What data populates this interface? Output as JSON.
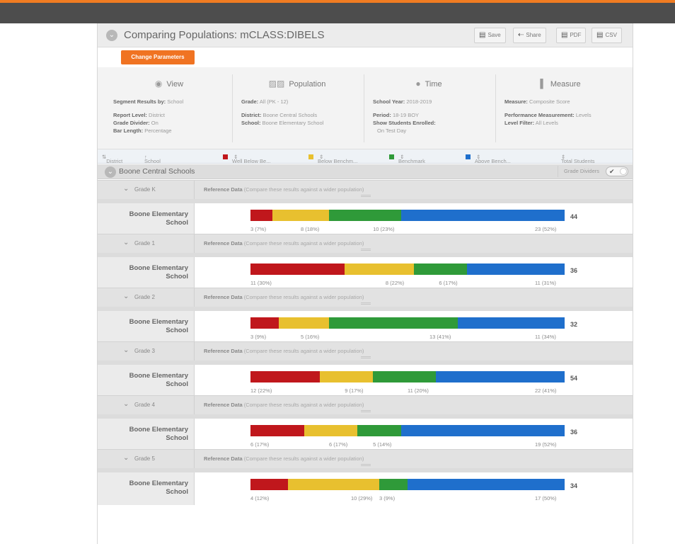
{
  "title": "Comparing Populations: mCLASS:DIBELS",
  "toolbar": {
    "save": "Save",
    "share": "Share",
    "pdf": "PDF",
    "csv": "CSV",
    "change_parameters": "Change Parameters"
  },
  "params": {
    "view": {
      "heading": "View",
      "segment_label": "Segment Results by:",
      "segment_value": "School",
      "level_label": "Report Level:",
      "level_value": "District",
      "divider_label": "Grade Divider:",
      "divider_value": "On",
      "bar_label": "Bar Length:",
      "bar_value": "Percentage"
    },
    "population": {
      "heading": "Population",
      "grade_label": "Grade:",
      "grade_value": "All (PK - 12)",
      "district_label": "District:",
      "district_value": "Boone Central Schools",
      "school_label": "School:",
      "school_value": "Boone Elementary School"
    },
    "time": {
      "heading": "Time",
      "year_label": "School Year:",
      "year_value": "2018-2019",
      "period_label": "Period:",
      "period_value": "18-19 BOY",
      "show_label": "Show Students Enrolled:",
      "show_value": "On Test Day"
    },
    "measure": {
      "heading": "Measure",
      "measure_label": "Measure:",
      "measure_value": "Composite Score",
      "perf_label": "Performance Measurement:",
      "perf_value": "Levels",
      "filter_label": "Level Filter:",
      "filter_value": "All Levels"
    }
  },
  "columns": {
    "district": "District",
    "school": "School",
    "well_below": "Well Below Be...",
    "below": "Below Benchm...",
    "benchmark": "Benchmark",
    "above": "Above Bench...",
    "total": "Total Students"
  },
  "colors": {
    "well_below": "#c0171c",
    "below": "#e8c02f",
    "benchmark": "#2f9a39",
    "above": "#1f6fcc"
  },
  "group": {
    "name": "Boone Central Schools",
    "grade_dividers": "Grade Dividers"
  },
  "reference": {
    "label": "Reference Data",
    "hint": "(Compare these results against a wider population)"
  },
  "grades": [
    {
      "grade": "Grade K",
      "school": [
        "Boone Elementary",
        "School"
      ],
      "total": "44",
      "segments": [
        {
          "pct": 7,
          "label": "3 (7%)"
        },
        {
          "pct": 18,
          "label": "8 (18%)"
        },
        {
          "pct": 23,
          "label": "10 (23%)"
        },
        {
          "pct": 52,
          "label": "23 (52%)"
        }
      ]
    },
    {
      "grade": "Grade 1",
      "school": [
        "Boone Elementary",
        "School"
      ],
      "total": "36",
      "segments": [
        {
          "pct": 30,
          "label": "11 (30%)"
        },
        {
          "pct": 22,
          "label": "8 (22%)"
        },
        {
          "pct": 17,
          "label": "6 (17%)"
        },
        {
          "pct": 31,
          "label": "11 (31%)"
        }
      ]
    },
    {
      "grade": "Grade 2",
      "school": [
        "Boone Elementary",
        "School"
      ],
      "total": "32",
      "segments": [
        {
          "pct": 9,
          "label": "3 (9%)"
        },
        {
          "pct": 16,
          "label": "5 (16%)"
        },
        {
          "pct": 41,
          "label": "13 (41%)"
        },
        {
          "pct": 34,
          "label": "11 (34%)"
        }
      ]
    },
    {
      "grade": "Grade 3",
      "school": [
        "Boone Elementary",
        "School"
      ],
      "total": "54",
      "segments": [
        {
          "pct": 22,
          "label": "12 (22%)"
        },
        {
          "pct": 17,
          "label": "9 (17%)"
        },
        {
          "pct": 20,
          "label": "11 (20%)"
        },
        {
          "pct": 41,
          "label": "22 (41%)"
        }
      ]
    },
    {
      "grade": "Grade 4",
      "school": [
        "Boone Elementary",
        "School"
      ],
      "total": "36",
      "segments": [
        {
          "pct": 17,
          "label": "6 (17%)"
        },
        {
          "pct": 17,
          "label": "6 (17%)"
        },
        {
          "pct": 14,
          "label": "5 (14%)"
        },
        {
          "pct": 52,
          "label": "19 (52%)"
        }
      ]
    },
    {
      "grade": "Grade 5",
      "school": [
        "Boone Elementary",
        "School"
      ],
      "total": "34",
      "segments": [
        {
          "pct": 12,
          "label": "4 (12%)"
        },
        {
          "pct": 29,
          "label": "10 (29%)"
        },
        {
          "pct": 9,
          "label": "3 (9%)"
        },
        {
          "pct": 50,
          "label": "17 (50%)"
        }
      ]
    }
  ]
}
